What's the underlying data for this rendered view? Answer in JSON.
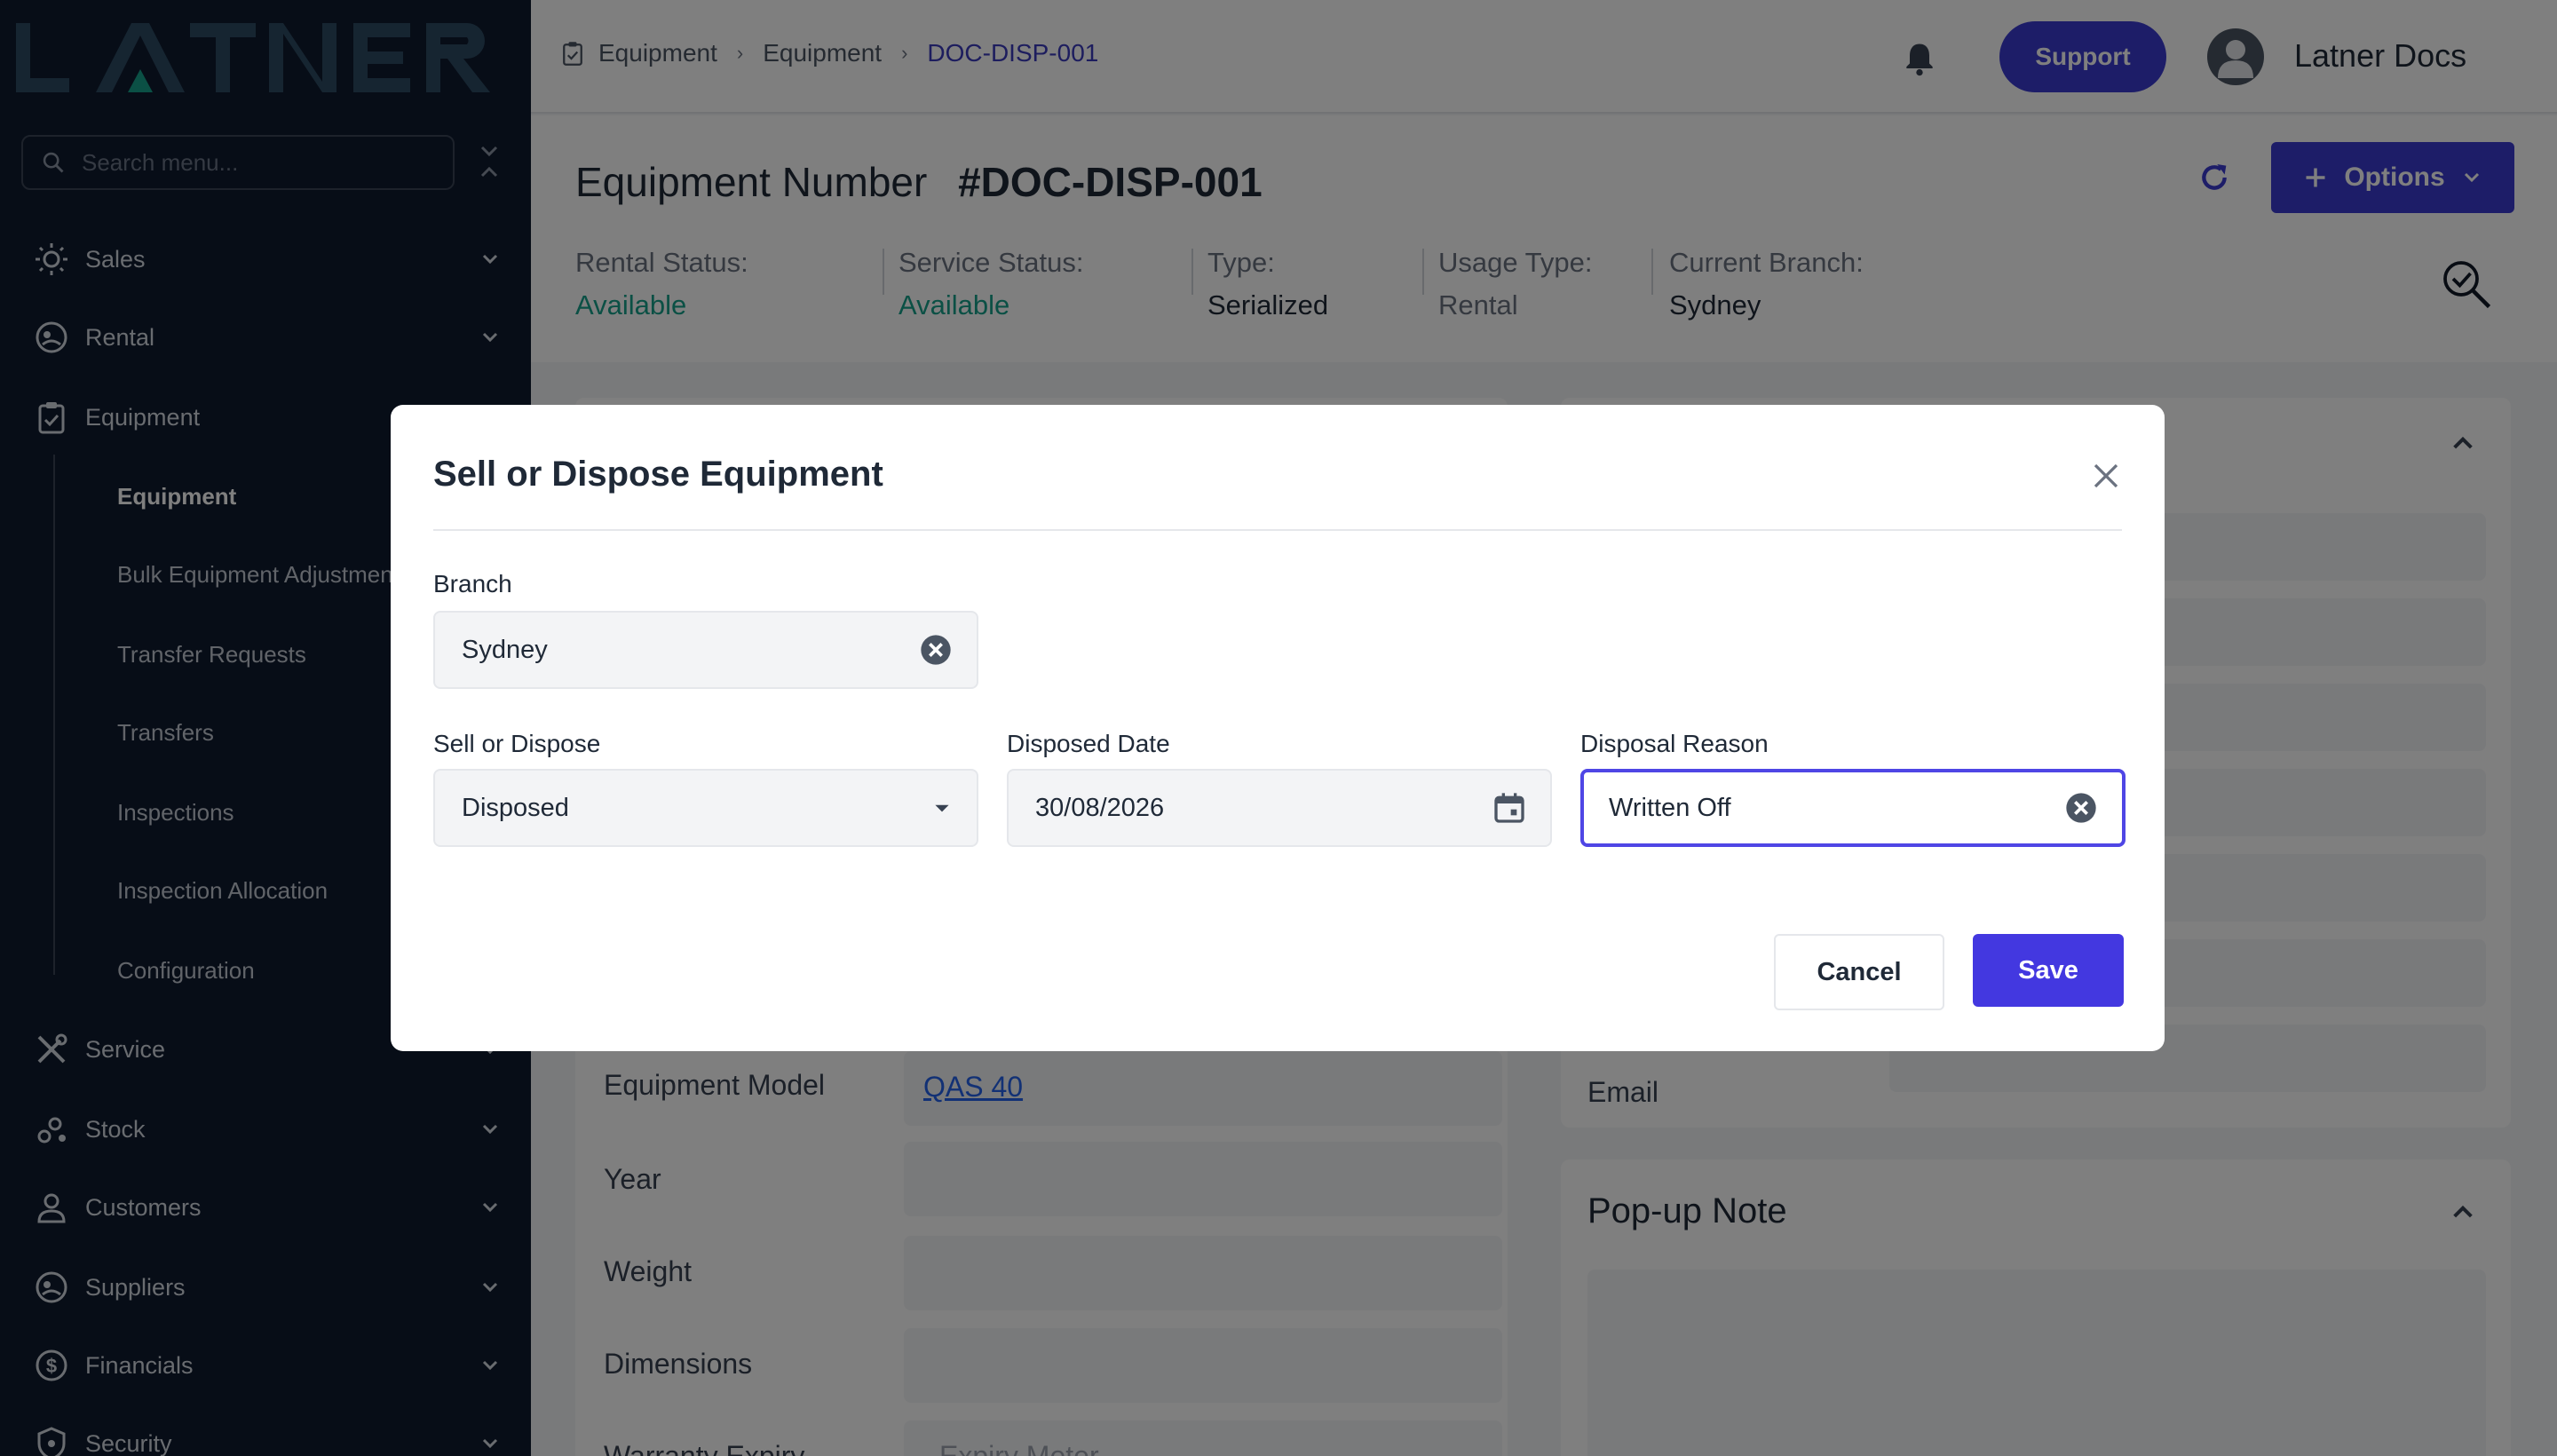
{
  "app": {
    "logo_text": "LATNER",
    "brand_color": "#3b3bd0"
  },
  "sidebar": {
    "search_placeholder": "Search menu...",
    "items": [
      {
        "label": "Sales",
        "icon": "sales-icon"
      },
      {
        "label": "Rental",
        "icon": "rental-icon"
      },
      {
        "label": "Equipment",
        "icon": "clipboard-icon"
      },
      {
        "label": "Service",
        "icon": "tools-icon"
      },
      {
        "label": "Stock",
        "icon": "stock-icon"
      },
      {
        "label": "Customers",
        "icon": "user-icon"
      },
      {
        "label": "Suppliers",
        "icon": "supplier-icon"
      },
      {
        "label": "Financials",
        "icon": "dollar-icon"
      },
      {
        "label": "Security",
        "icon": "shield-icon"
      }
    ],
    "equipment_sub": [
      "Equipment",
      "Bulk Equipment Adjustments",
      "Transfer Requests",
      "Transfers",
      "Inspections",
      "Inspection Allocation",
      "Configuration"
    ]
  },
  "header": {
    "breadcrumb": [
      "Equipment",
      "Equipment",
      "DOC-DISP-001"
    ],
    "support_label": "Support",
    "user_name": "Latner Docs"
  },
  "page": {
    "title_prefix": "Equipment Number",
    "title_id": "#DOC-DISP-001",
    "options_label": "Options",
    "stats": [
      {
        "label": "Rental Status:",
        "value": "Available"
      },
      {
        "label": "Service Status:",
        "value": "Available"
      },
      {
        "label": "Type:",
        "value": "Serialized"
      },
      {
        "label": "Usage Type:",
        "value": "Rental"
      },
      {
        "label": "Current Branch:",
        "value": "Sydney"
      }
    ]
  },
  "details": {
    "equipment_model_label": "Equipment Model",
    "equipment_model_value": "QAS 40",
    "year_label": "Year",
    "weight_label": "Weight",
    "dimensions_label": "Dimensions",
    "warranty_label": "Warranty Expiry",
    "expiry_meter_placeholder": "Expiry Meter",
    "email_label": "Email",
    "popup_note_title": "Pop-up Note"
  },
  "modal": {
    "title": "Sell or Dispose Equipment",
    "branch_label": "Branch",
    "branch_value": "Sydney",
    "sell_dispose_label": "Sell or Dispose",
    "sell_dispose_value": "Disposed",
    "disposed_date_label": "Disposed Date",
    "disposed_date_value": "30/08/2026",
    "disposal_reason_label": "Disposal Reason",
    "disposal_reason_value": "Written Off",
    "cancel_label": "Cancel",
    "save_label": "Save"
  }
}
